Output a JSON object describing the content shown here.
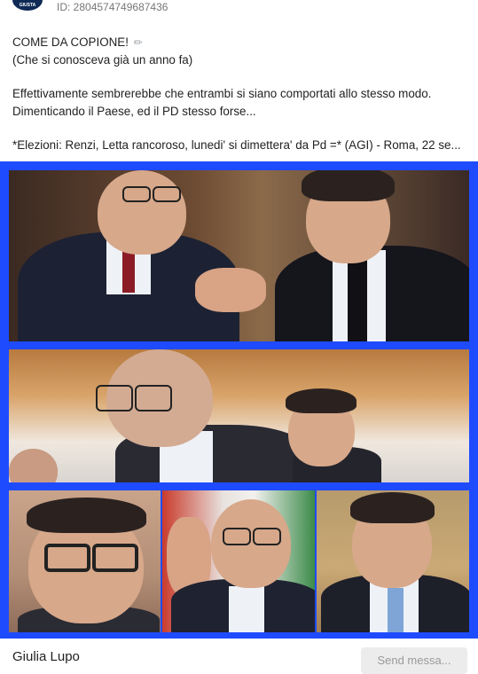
{
  "post": {
    "id_label": "ID: 2804574749687436",
    "avatar_text": "GIUSTA",
    "lines": {
      "l1": "COME DA COPIONE! ",
      "l1_icon": "pencil-icon",
      "l2": "(Che si conosceva già un anno fa)",
      "l3": "Effettivamente sembrerebbe che entrambi si siano comportati allo stesso modo.",
      "l4": "Dimenticando il Paese, ed il PD stesso forse...",
      "l5": "*Elezioni: Renzi, Letta rancoroso, lunedi' si dimettera' da Pd =* (AGI) - Roma, 22 se..."
    }
  },
  "collage": {
    "border_color": "#1f4bff"
  },
  "footer": {
    "author": "Giulia Lupo",
    "send_button": "Send messa..."
  }
}
